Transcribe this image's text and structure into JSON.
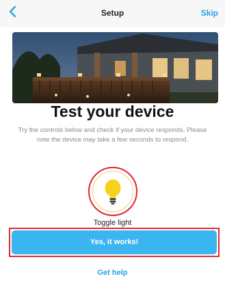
{
  "header": {
    "back_icon": "chevron-left-icon",
    "title": "Setup",
    "skip_label": "Skip"
  },
  "hero": {
    "image_description": "house-porch-night-lights"
  },
  "main": {
    "heading": "Test your device",
    "description": "Try the controls below and check if your device responds. Please note the device may take a few seconds to respond.",
    "bulb_icon": "lightbulb-icon",
    "toggle_label": "Toggle light",
    "confirm_button_label": "Yes, it works!",
    "help_link_label": "Get help"
  },
  "colors": {
    "accent": "#2aa1e3",
    "button": "#3bb5ef",
    "bulb": "#f7d21c",
    "annotation": "#e0262e"
  }
}
